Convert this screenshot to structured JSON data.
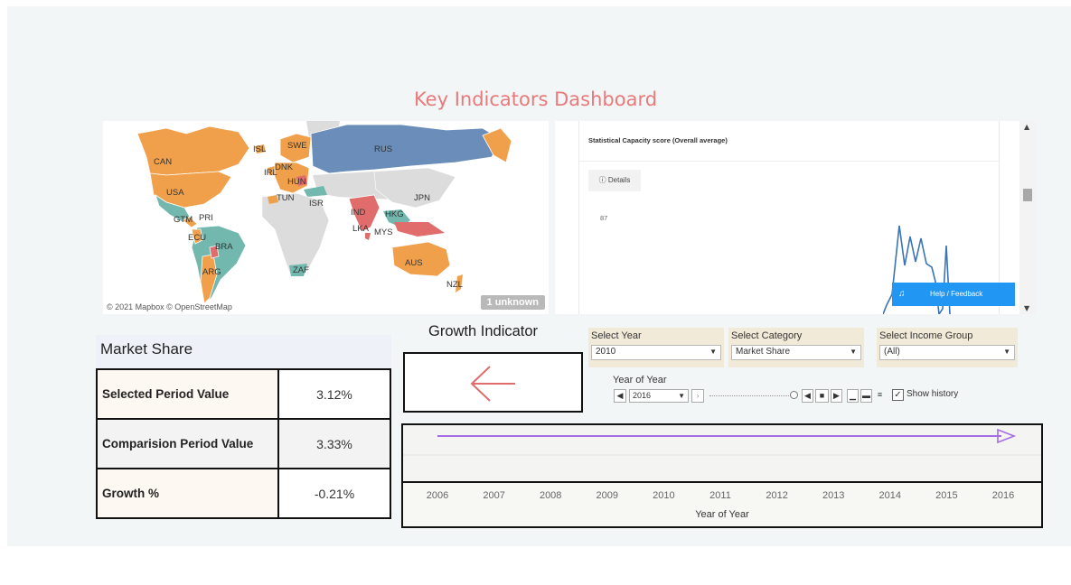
{
  "dashboard": {
    "title": "Key Indicators Dashboard"
  },
  "map": {
    "credit": "© 2021 Mapbox © OpenStreetMap",
    "unknown_badge": "1 unknown",
    "country_labels": [
      "CAN",
      "USA",
      "ISL",
      "SWE",
      "RUS",
      "IRL",
      "DNK",
      "HUN",
      "TUN",
      "ISR",
      "JPN",
      "IND",
      "HKG",
      "LKA",
      "MYS",
      "GTM",
      "PRI",
      "ECU",
      "BRA",
      "ARG",
      "ZAF",
      "AUS",
      "NZL"
    ],
    "colors": {
      "orange": "#f0a04b",
      "blue": "#6a8db9",
      "teal": "#72b8ae",
      "red": "#e06c6b",
      "gray": "#dcdcdc",
      "ocean": "#ffffff"
    }
  },
  "web_panel": {
    "title": "Statistical Capacity score (Overall average)",
    "details_label": "Details",
    "y_value": "87",
    "help_label": "Help / Feedback"
  },
  "market_share": {
    "header": "Market Share",
    "rows": [
      {
        "label": "Selected Period Value",
        "value": "3.12%"
      },
      {
        "label": "Comparision Period Value",
        "value": "3.33%"
      },
      {
        "label": "Growth  %",
        "value": "-0.21%"
      }
    ]
  },
  "growth_indicator": {
    "title": "Growth Indicator",
    "direction": "left-arrow",
    "color": "#e06c6b"
  },
  "filters": [
    {
      "label": "Select Year",
      "value": "2010"
    },
    {
      "label": "Select Category",
      "value": "Market Share"
    },
    {
      "label": "Select Income Group",
      "value": "(All)"
    }
  ],
  "year_slider": {
    "label": "Year of Year",
    "value": "2016",
    "show_history_label": "Show history",
    "show_history_checked": true
  },
  "timeline": {
    "axis_label": "Year of Year",
    "ticks": [
      "2006",
      "2007",
      "2008",
      "2009",
      "2010",
      "2011",
      "2012",
      "2013",
      "2014",
      "2015",
      "2016"
    ],
    "line_color": "#a56de2"
  }
}
